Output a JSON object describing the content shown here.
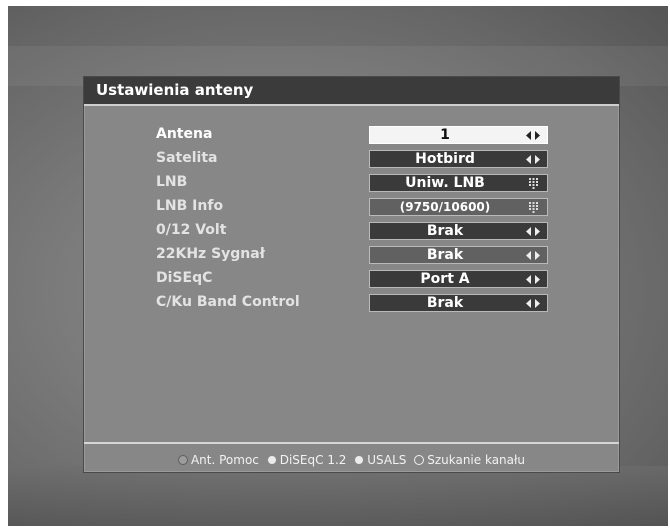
{
  "window": {
    "title": "Ustawienia anteny"
  },
  "rows": [
    {
      "label": "Antena",
      "value": "1",
      "control": "arrows",
      "selected": true
    },
    {
      "label": "Satelita",
      "value": "Hotbird",
      "control": "arrows"
    },
    {
      "label": "LNB",
      "value": "Uniw. LNB",
      "control": "grid"
    },
    {
      "label": "LNB Info",
      "value": "(9750/10600)",
      "control": "grid"
    },
    {
      "label": "0/12 Volt",
      "value": "Brak",
      "control": "arrows"
    },
    {
      "label": "22KHz Sygnał",
      "value": "Brak",
      "control": "arrows"
    },
    {
      "label": "DiSEqC",
      "value": "Port A",
      "control": "arrows"
    },
    {
      "label": "C/Ku Band Control",
      "value": "Brak",
      "control": "arrows"
    }
  ],
  "footer": {
    "items": [
      {
        "label": "Ant. Pomoc",
        "color": "#9c9c9c"
      },
      {
        "label": "DiSEqC 1.2",
        "color": "#e0e0e0"
      },
      {
        "label": "USALS",
        "color": "#ececec"
      },
      {
        "label": "Szukanie kanału",
        "color": "none"
      }
    ]
  },
  "colors": {
    "header": "#3b3b3b",
    "panel": "#878787",
    "value_box": "#3a3a3a",
    "selected_box": "#f4f4f4"
  }
}
